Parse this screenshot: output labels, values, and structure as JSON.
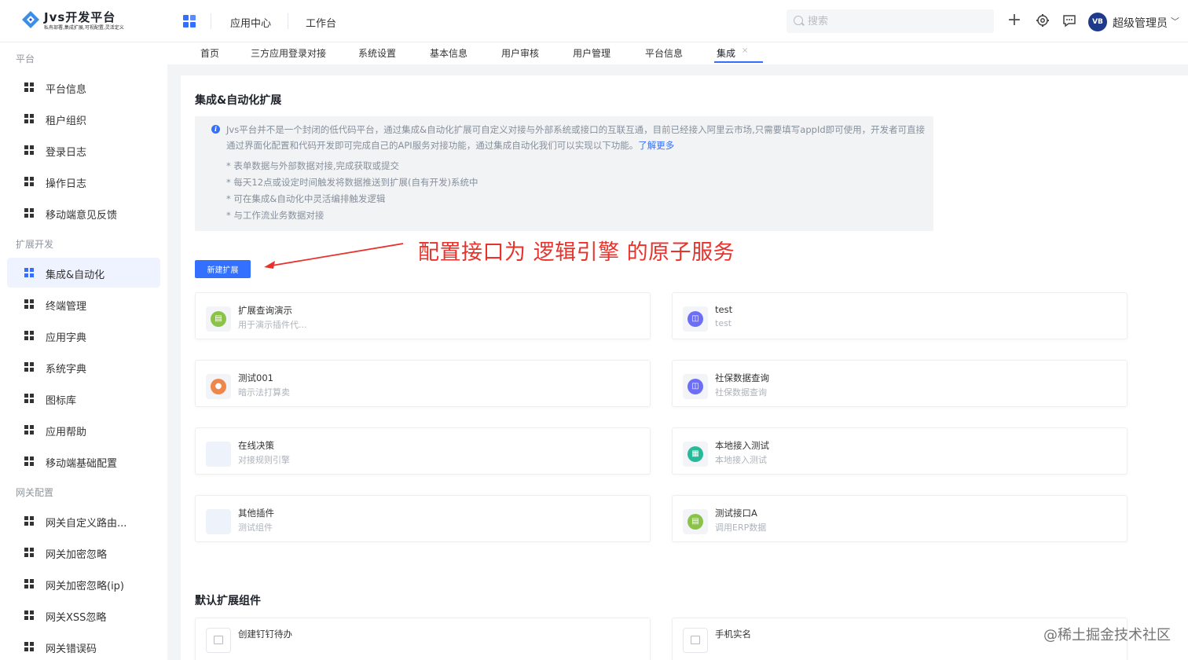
{
  "header": {
    "logo_title": "Jvs开发平台",
    "logo_subtitle": "私有部署,集成扩展,可视配置,灵活定义",
    "nav": [
      {
        "label": "应用中心"
      },
      {
        "label": "工作台"
      }
    ],
    "search_placeholder": "搜索",
    "icons": [
      "plus-icon",
      "settings-icon",
      "message-icon"
    ],
    "avatar_text": "VB",
    "user_name": "超级管理员"
  },
  "sidebar": {
    "groups": [
      {
        "title": "平台",
        "items": [
          {
            "label": "平台信息"
          },
          {
            "label": "租户组织"
          },
          {
            "label": "登录日志"
          },
          {
            "label": "操作日志"
          },
          {
            "label": "移动端意见反馈"
          }
        ]
      },
      {
        "title": "扩展开发",
        "items": [
          {
            "label": "集成&自动化",
            "active": true
          },
          {
            "label": "终端管理"
          },
          {
            "label": "应用字典"
          },
          {
            "label": "系统字典"
          },
          {
            "label": "图标库"
          },
          {
            "label": "应用帮助"
          },
          {
            "label": "移动端基础配置"
          }
        ]
      },
      {
        "title": "网关配置",
        "items": [
          {
            "label": "网关自定义路由..."
          },
          {
            "label": "网关加密忽略"
          },
          {
            "label": "网关加密忽略(ip)"
          },
          {
            "label": "网关XSS忽略"
          },
          {
            "label": "网关错误码"
          }
        ]
      }
    ]
  },
  "tabs": [
    {
      "label": "首页"
    },
    {
      "label": "三方应用登录对接"
    },
    {
      "label": "系统设置"
    },
    {
      "label": "基本信息"
    },
    {
      "label": "用户审核"
    },
    {
      "label": "用户管理"
    },
    {
      "label": "平台信息"
    },
    {
      "label": "集成",
      "active": true,
      "closable": true
    }
  ],
  "main": {
    "section_title": "集成&自动化扩展",
    "info_text": "Jvs平台并不是一个封闭的低代码平台，通过集成&自动化扩展可自定义对接与外部系统或接口的互联互通，目前已经接入阿里云市场,只需要填写appId即可使用，开发者可直接通过界面化配置和代码开发即可完成自己的API服务对接功能，通过集成自动化我们可以实现以下功能。",
    "learn_more": "了解更多",
    "bullets": [
      "* 表单数据与外部数据对接,完成获取或提交",
      "* 每天12点或设定时间触发将数据推送到扩展(自有开发)系统中",
      "* 可在集成&自动化中灵活编排触发逻辑",
      "* 与工作流业务数据对接"
    ],
    "annotation": "配置接口为 逻辑引擎 的原子服务",
    "new_button": "新建扩展",
    "cards": [
      {
        "title": "扩展查询演示",
        "desc": "用于演示插件代...",
        "icon": "chat-icon",
        "color": "#8bc34a",
        "glyph": "▤"
      },
      {
        "title": "test",
        "desc": "test",
        "icon": "chart-icon",
        "color": "#6c6ff5",
        "glyph": "◫"
      },
      {
        "title": "测试001",
        "desc": "暗示法打算卖",
        "icon": "user-icon",
        "color": "#f0874a",
        "glyph": "●"
      },
      {
        "title": "社保数据查询",
        "desc": "社保数据查询",
        "icon": "chart-icon",
        "color": "#6c6ff5",
        "glyph": "◫"
      },
      {
        "title": "在线决策",
        "desc": "对接规则引擎",
        "icon": "",
        "color": "",
        "glyph": ""
      },
      {
        "title": "本地接入测试",
        "desc": "本地接入测试",
        "icon": "grid-icon",
        "color": "#26b99a",
        "glyph": "▦"
      },
      {
        "title": "其他插件",
        "desc": "测试组件",
        "icon": "",
        "color": "",
        "glyph": ""
      },
      {
        "title": "测试接口A",
        "desc": "调用ERP数据",
        "icon": "chat-icon",
        "color": "#8bc34a",
        "glyph": "▤"
      }
    ],
    "default_title": "默认扩展组件",
    "default_cards": [
      {
        "title": "创建钉钉待办",
        "icon": "table-icon"
      },
      {
        "title": "手机实名",
        "icon": "table-icon"
      }
    ]
  },
  "watermark": "@稀土掘金技术社区"
}
